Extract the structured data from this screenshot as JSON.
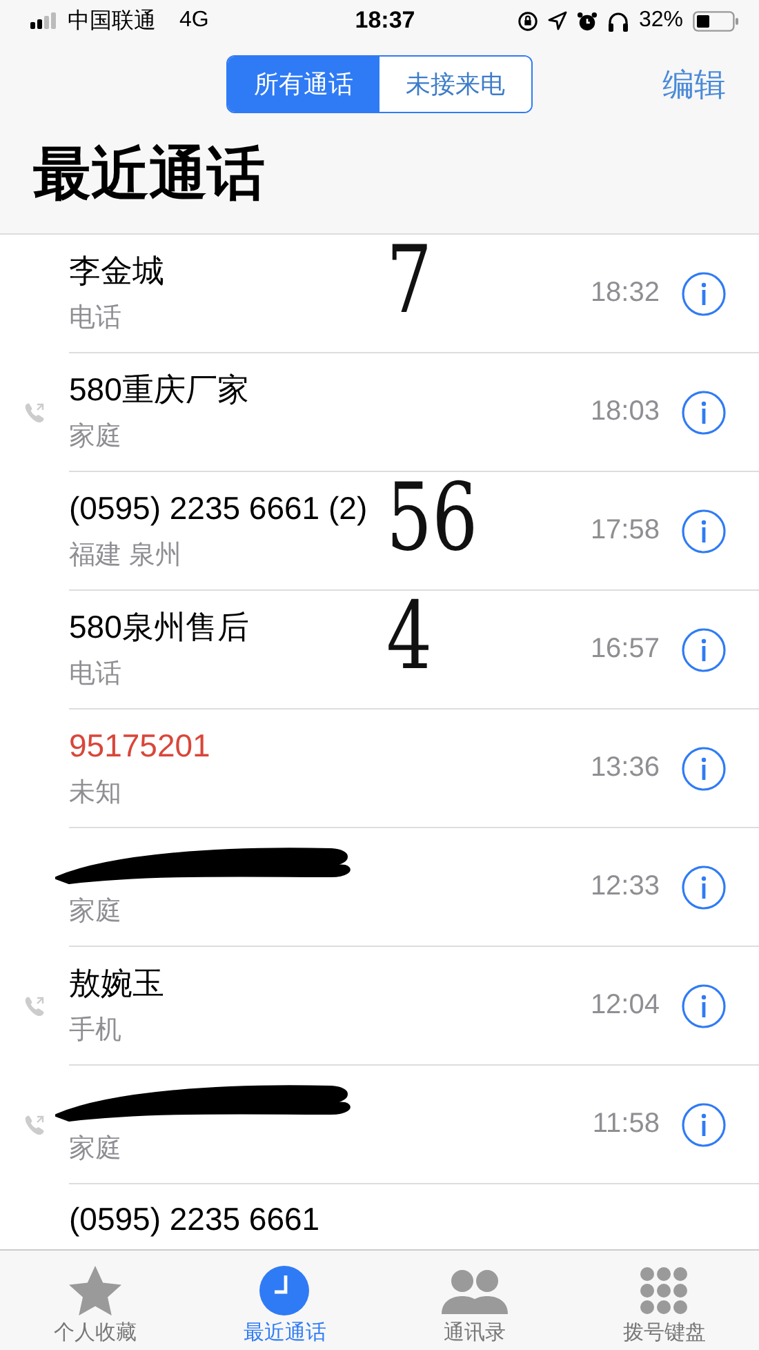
{
  "status_bar": {
    "carrier": "中国联通",
    "network": "4G",
    "time": "18:37",
    "battery": "32%"
  },
  "segments": [
    {
      "label": "所有通话",
      "selected": true
    },
    {
      "label": "未接来电",
      "selected": false
    }
  ],
  "edit_button": "编辑",
  "title": "最近通话",
  "calls": [
    {
      "name": "李金城",
      "redacted": false,
      "missed": false,
      "outgoing": false,
      "type": "电话",
      "time": "18:32",
      "note": "7"
    },
    {
      "name": "580重庆厂家",
      "redacted": false,
      "missed": false,
      "outgoing": true,
      "type": "家庭",
      "time": "18:03"
    },
    {
      "name": "(0595) 2235 6661 (2)",
      "redacted": false,
      "missed": false,
      "outgoing": false,
      "type": "福建 泉州",
      "time": "17:58",
      "note": "56"
    },
    {
      "name": "580泉州售后",
      "redacted": false,
      "missed": false,
      "outgoing": false,
      "type": "电话",
      "time": "16:57",
      "note": "4"
    },
    {
      "name": "95175201",
      "redacted": false,
      "missed": true,
      "outgoing": false,
      "type": "未知",
      "time": "13:36"
    },
    {
      "redacted": true,
      "outgoing": false,
      "type": "家庭",
      "time": "12:33"
    },
    {
      "name": "敖婉玉",
      "redacted": false,
      "missed": false,
      "outgoing": true,
      "type": "手机",
      "time": "12:04"
    },
    {
      "redacted": true,
      "outgoing": true,
      "type": "家庭",
      "time": "11:58"
    }
  ],
  "partial_call": "(0595) 2235 6661",
  "tab_bar": [
    {
      "label": "个人收藏",
      "kind": "star",
      "selected": false
    },
    {
      "label": "最近通话",
      "kind": "clock",
      "selected": true
    },
    {
      "label": "通讯录",
      "kind": "people",
      "selected": false
    },
    {
      "label": "拨号键盘",
      "kind": "keypad",
      "selected": false
    }
  ]
}
